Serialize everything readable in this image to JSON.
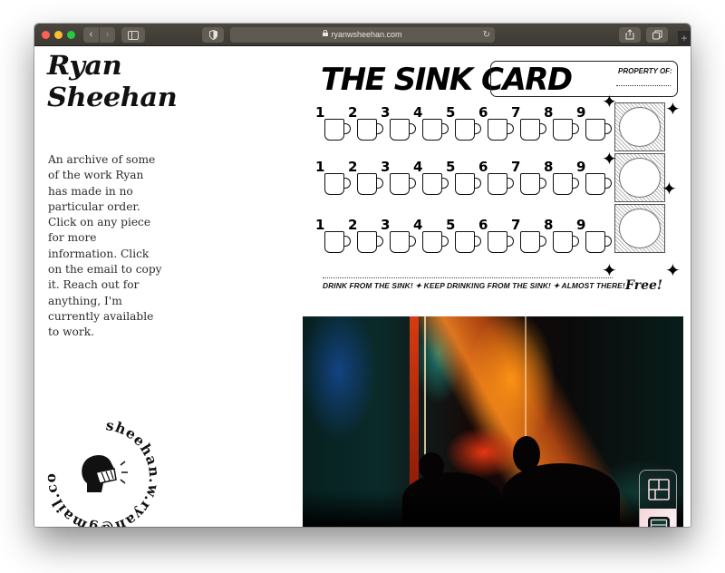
{
  "browser": {
    "url": "ryanwsheehan.com",
    "icons": {
      "back": "chevron-left-icon",
      "forward": "chevron-right-icon",
      "sidebar": "sidebar-icon",
      "privacy": "shield-icon",
      "lock": "lock-icon",
      "reload": "reload-icon",
      "share": "share-icon",
      "tabs": "tabs-overview-icon",
      "new_tab": "plus-icon"
    },
    "glyphs": {
      "back": "‹",
      "forward": "›",
      "sidebar": "▯",
      "privacy": "◐",
      "lock": "🔒",
      "reload": "↻",
      "share": "⇧",
      "tabs": "⧉",
      "new_tab": "+"
    }
  },
  "site": {
    "title_line1": "Ryan",
    "title_line2": "Sheehan",
    "intro": "An archive of some of the work Ryan has made in no particular order. Click on any piece for more information. Click on the email to copy it. Reach out for anything, I'm currently available to work.",
    "email": "sheehan.w.ryan@gmail.com"
  },
  "gallery": {
    "items": [
      {
        "name": "The Sink Card",
        "title": "THE SINK CARD",
        "property_label": "PROPERTY OF:",
        "row_numbers": [
          [
            "1",
            "2",
            "3",
            "4",
            "5",
            "6",
            "7",
            "8",
            "9"
          ],
          [
            "1",
            "2",
            "3",
            "4",
            "5",
            "6",
            "7",
            "8",
            "9"
          ],
          [
            "1",
            "2",
            "3",
            "4",
            "5",
            "6",
            "7",
            "8",
            "9"
          ]
        ],
        "footer": "DRINK FROM THE SINK! ✦ KEEP DRINKING FROM THE SINK! ✦ ALMOST THERE!",
        "free_label": "Free!"
      },
      {
        "name": "Neon concert photograph",
        "alt": "Long-exposure photo of silhouetted figures in orange, red and teal light"
      }
    ]
  },
  "view_toggle": {
    "options": [
      {
        "name": "grid-view",
        "icon": "grid-icon",
        "active": false
      },
      {
        "name": "list-view",
        "icon": "list-icon",
        "active": true
      }
    ],
    "accent": "#f4d6da"
  },
  "colors": {
    "toolbar": "#3d3a34",
    "text": "#2a2a2a",
    "traffic_red": "#fe5f57",
    "traffic_yellow": "#febc2e",
    "traffic_green": "#28c840"
  }
}
